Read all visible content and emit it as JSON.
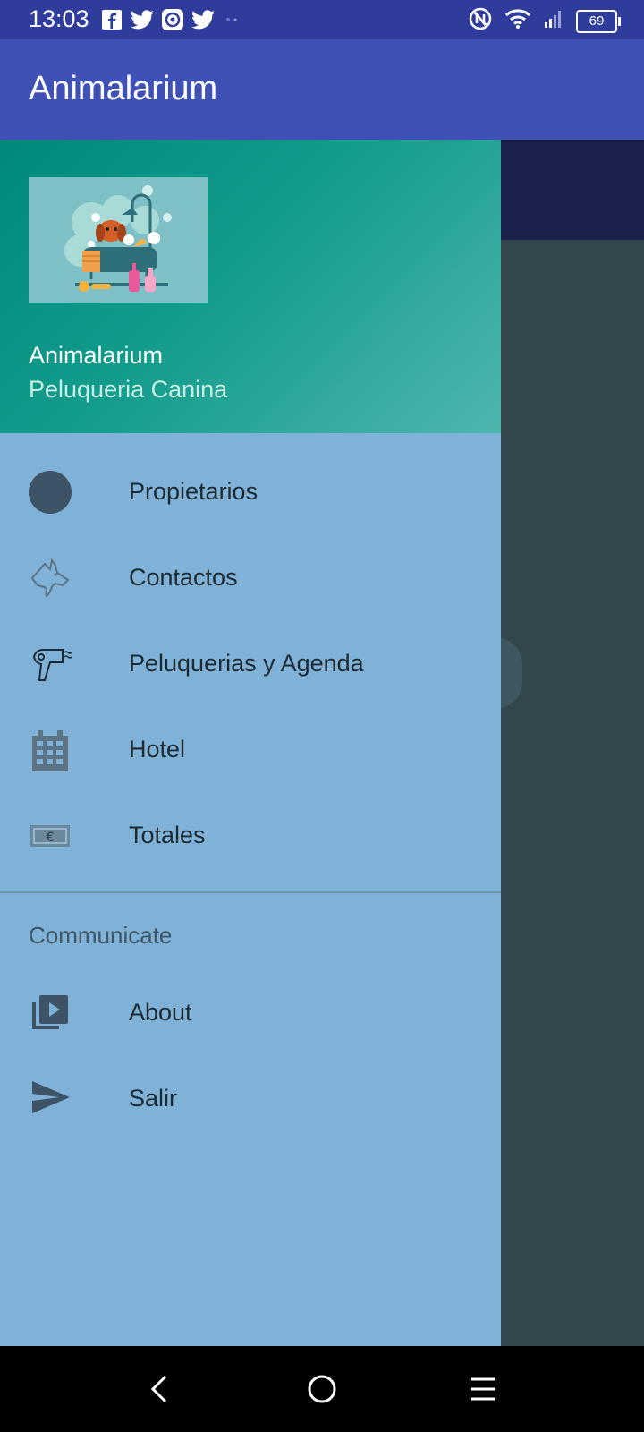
{
  "status_bar": {
    "time": "13:03",
    "left_icons": [
      "facebook-icon",
      "twitter-icon",
      "app-icon",
      "twitter-icon"
    ],
    "right_icons": [
      "nfc-icon",
      "wifi-icon",
      "signal-icon"
    ],
    "battery": "69"
  },
  "app_bar": {
    "title": "Animalarium"
  },
  "drawer": {
    "header": {
      "image": "dog-bath-illustration",
      "name": "Animalarium",
      "subtitle": "Peluqueria Canina"
    },
    "items": [
      {
        "label": "Propietarios",
        "icon": "circle-icon"
      },
      {
        "label": "Contactos",
        "icon": "dog-head-icon"
      },
      {
        "label": "Peluquerias y Agenda",
        "icon": "hair-dryer-icon"
      },
      {
        "label": "Hotel",
        "icon": "building-icon"
      },
      {
        "label": "Totales",
        "icon": "euro-banknote-icon"
      }
    ],
    "section_title": "Communicate",
    "section_items": [
      {
        "label": "About",
        "icon": "video-library-icon"
      },
      {
        "label": "Salir",
        "icon": "send-icon"
      }
    ]
  },
  "nav_bar": {
    "buttons": [
      "back-icon",
      "home-icon",
      "menu-icon"
    ]
  },
  "colors": {
    "app_bar": "#3f51b5",
    "status_bar": "#2f3c9c",
    "drawer_bg": "#7fb2d6",
    "header_teal": "#00897b"
  }
}
